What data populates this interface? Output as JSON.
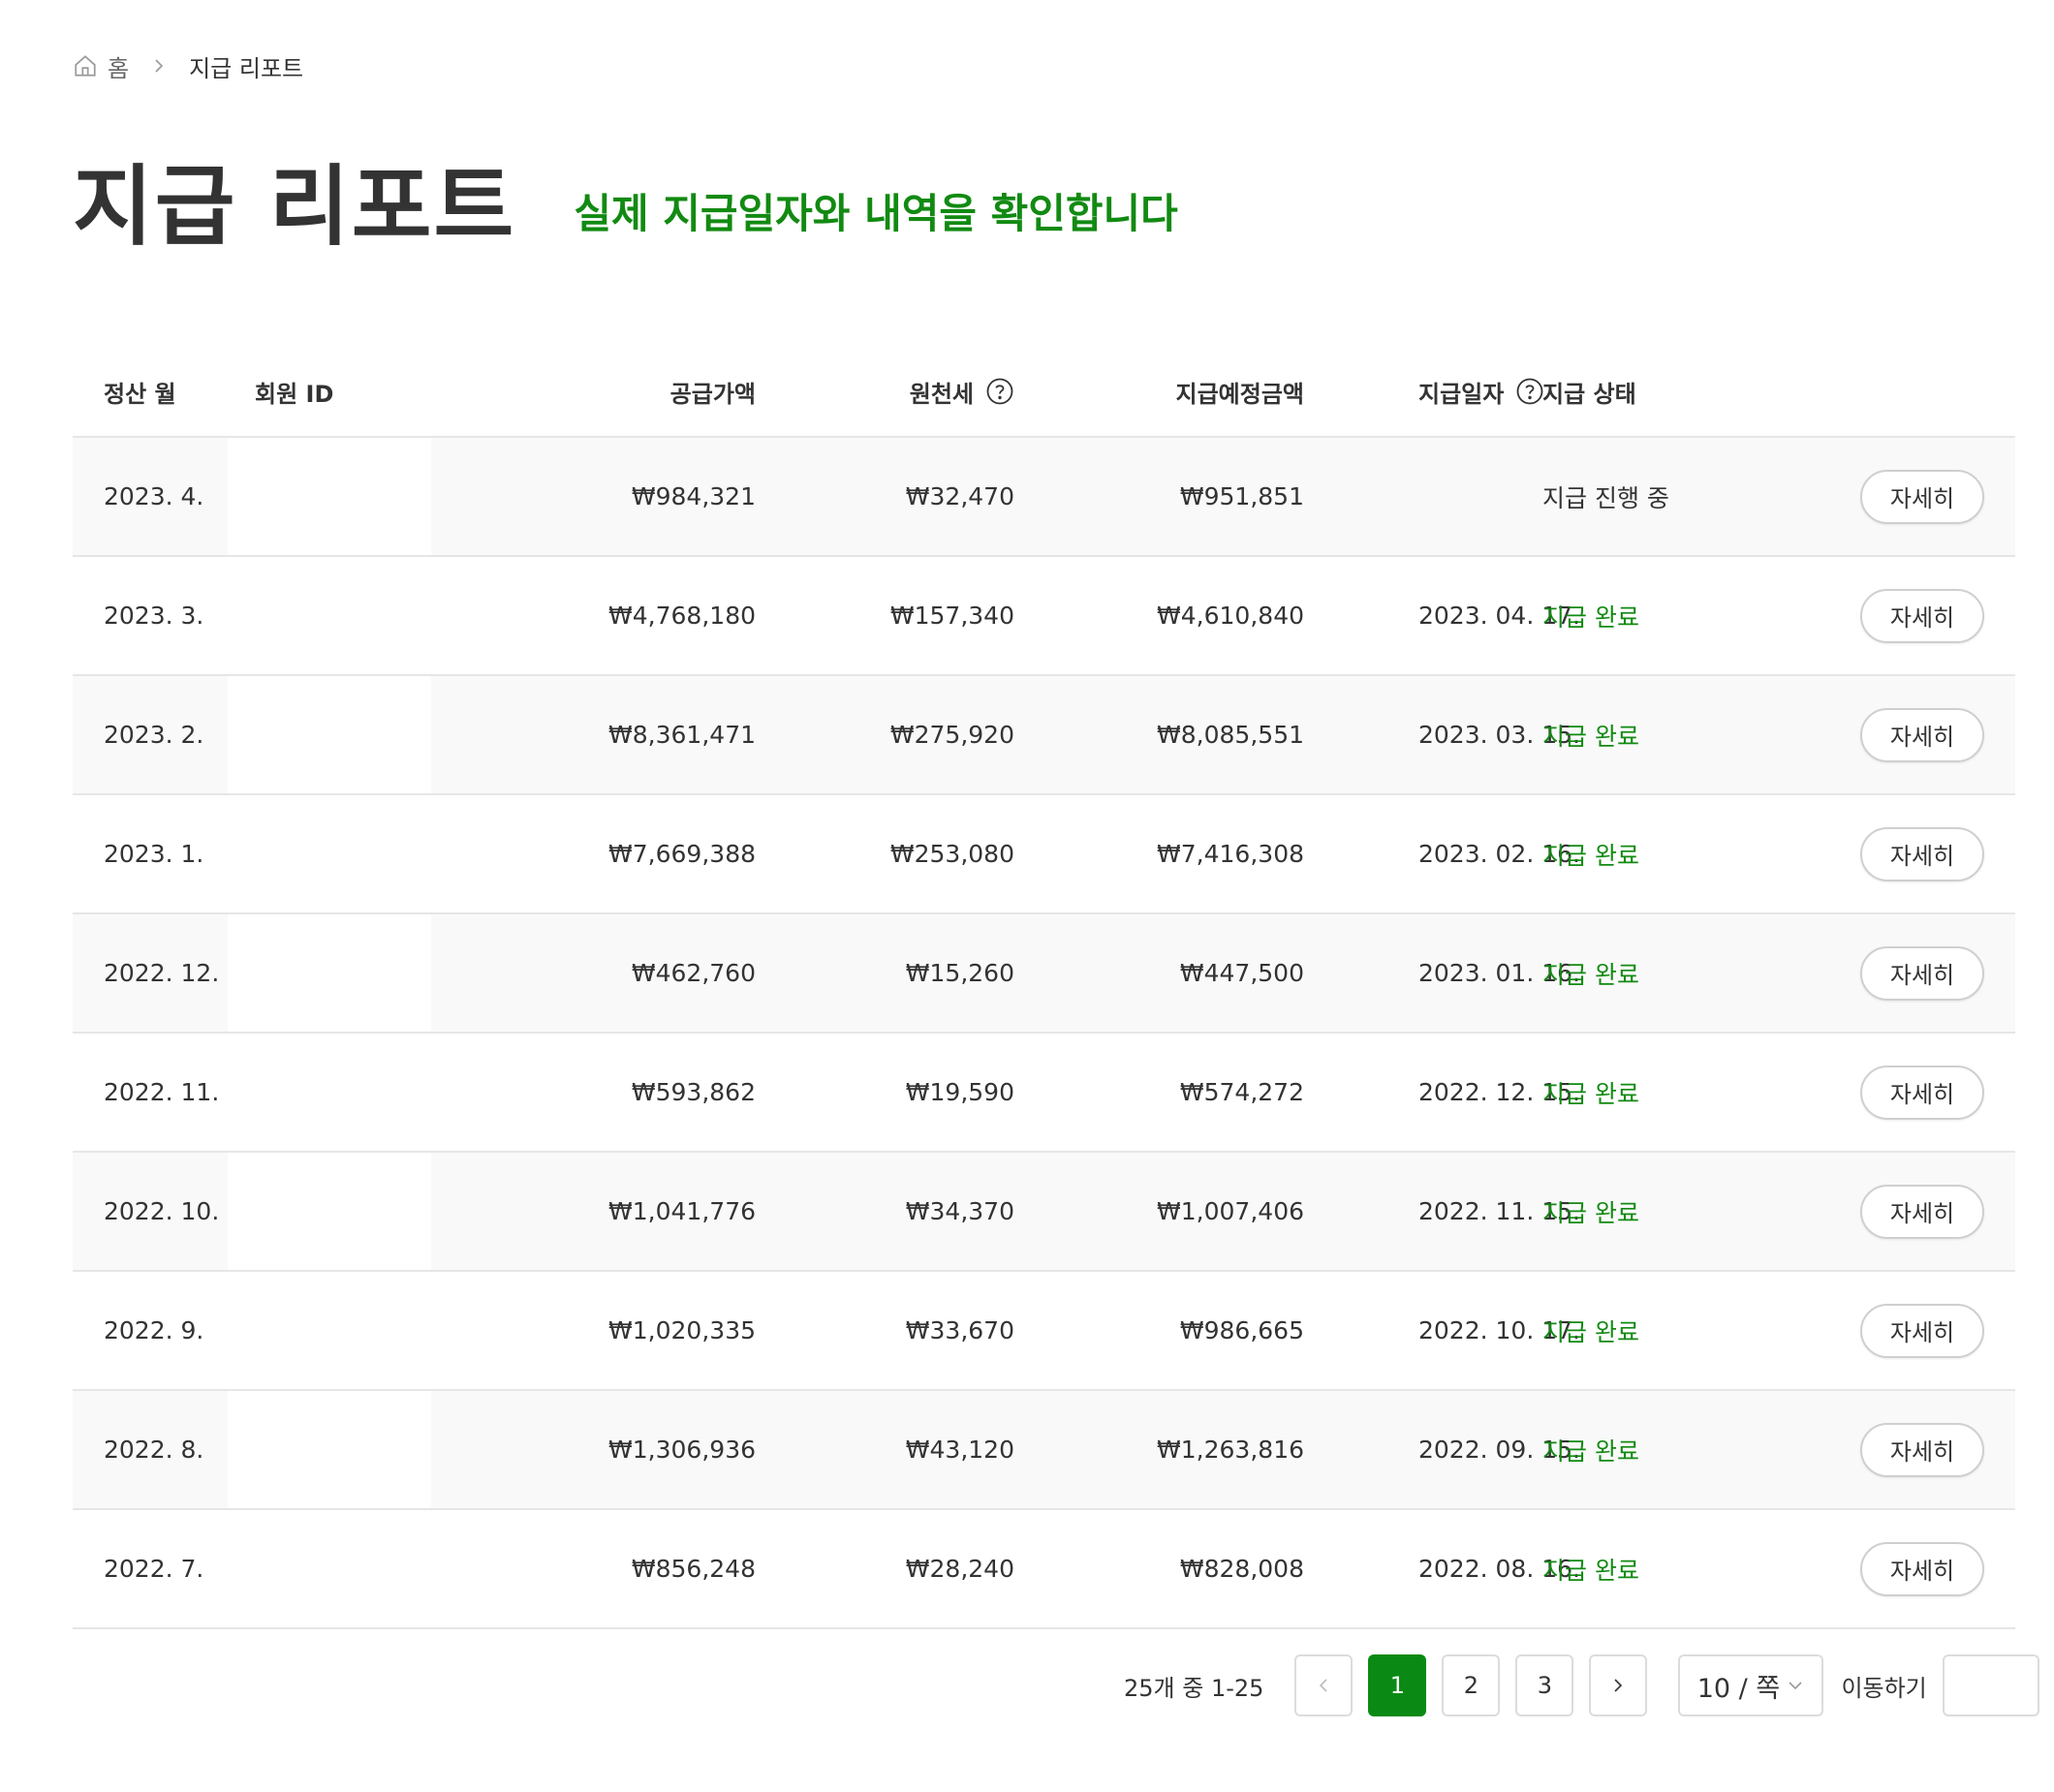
{
  "breadcrumb": {
    "home_label": "홈",
    "current": "지급 리포트"
  },
  "header": {
    "title": "지급 리포트",
    "subtitle": "실제 지급일자와 내역을 확인합니다"
  },
  "colors": {
    "accent": "#128a12",
    "active_page": "#0a8a14",
    "text": "#333333",
    "row_alt": "#f9f9f9",
    "border": "#e6e6e6"
  },
  "table": {
    "columns": {
      "month": "정산 월",
      "member": "회원 ID",
      "supply": "공급가액",
      "tax": "원천세",
      "expected": "지급예정금액",
      "date": "지급일자",
      "status": "지급 상태"
    },
    "detail_label": "자세히",
    "rows": [
      {
        "month": "2023. 4.",
        "supply": "₩984,321",
        "tax": "₩32,470",
        "expected": "₩951,851",
        "date": "",
        "status": "지급 진행 중",
        "status_type": "progress"
      },
      {
        "month": "2023. 3.",
        "supply": "₩4,768,180",
        "tax": "₩157,340",
        "expected": "₩4,610,840",
        "date": "2023. 04. 17.",
        "status": "지급 완료",
        "status_type": "done"
      },
      {
        "month": "2023. 2.",
        "supply": "₩8,361,471",
        "tax": "₩275,920",
        "expected": "₩8,085,551",
        "date": "2023. 03. 15.",
        "status": "지급 완료",
        "status_type": "done"
      },
      {
        "month": "2023. 1.",
        "supply": "₩7,669,388",
        "tax": "₩253,080",
        "expected": "₩7,416,308",
        "date": "2023. 02. 16.",
        "status": "지급 완료",
        "status_type": "done"
      },
      {
        "month": "2022. 12.",
        "supply": "₩462,760",
        "tax": "₩15,260",
        "expected": "₩447,500",
        "date": "2023. 01. 16.",
        "status": "지급 완료",
        "status_type": "done"
      },
      {
        "month": "2022. 11.",
        "supply": "₩593,862",
        "tax": "₩19,590",
        "expected": "₩574,272",
        "date": "2022. 12. 15.",
        "status": "지급 완료",
        "status_type": "done"
      },
      {
        "month": "2022. 10.",
        "supply": "₩1,041,776",
        "tax": "₩34,370",
        "expected": "₩1,007,406",
        "date": "2022. 11. 15.",
        "status": "지급 완료",
        "status_type": "done"
      },
      {
        "month": "2022. 9.",
        "supply": "₩1,020,335",
        "tax": "₩33,670",
        "expected": "₩986,665",
        "date": "2022. 10. 17.",
        "status": "지급 완료",
        "status_type": "done"
      },
      {
        "month": "2022. 8.",
        "supply": "₩1,306,936",
        "tax": "₩43,120",
        "expected": "₩1,263,816",
        "date": "2022. 09. 15.",
        "status": "지급 완료",
        "status_type": "done"
      },
      {
        "month": "2022. 7.",
        "supply": "₩856,248",
        "tax": "₩28,240",
        "expected": "₩828,008",
        "date": "2022. 08. 16.",
        "status": "지급 완료",
        "status_type": "done"
      }
    ]
  },
  "pagination": {
    "summary": "25개 중 1-25",
    "pages": [
      "1",
      "2",
      "3"
    ],
    "current_page": "1",
    "page_size": "10 / 쪽",
    "goto_label": "이동하기",
    "goto_value": ""
  }
}
